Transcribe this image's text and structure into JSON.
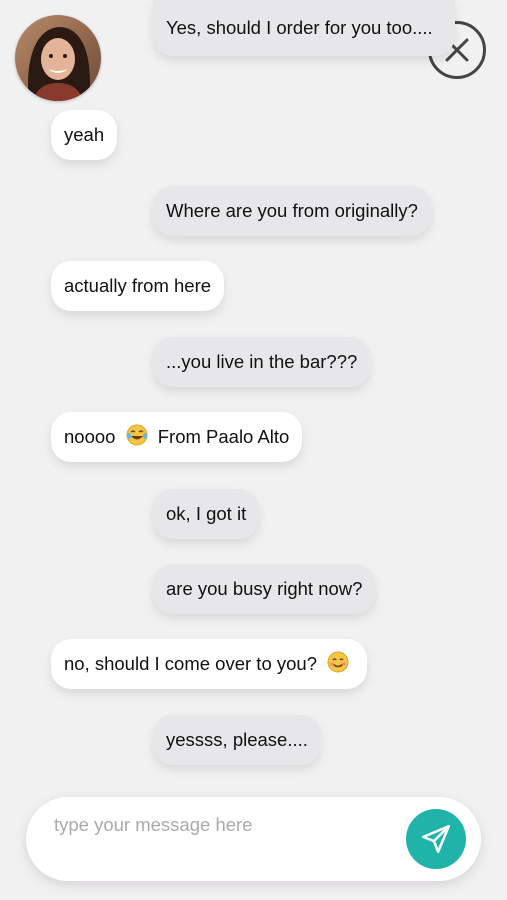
{
  "chat": {
    "contact_avatar": "woman-portrait-avatar",
    "close_icon": "close-icon",
    "messages": [
      {
        "sender": "me",
        "text": "Yes, should I order for you too...."
      },
      {
        "sender": "them",
        "text": "yeah"
      },
      {
        "sender": "me",
        "text": "Where are you from originally?"
      },
      {
        "sender": "them",
        "text": "actually from here"
      },
      {
        "sender": "me",
        "text": "...you live in the bar???"
      },
      {
        "sender": "them",
        "text_before": "noooo",
        "emoji": "tears-of-joy-emoji",
        "text_after": "From Paalo Alto"
      },
      {
        "sender": "me",
        "text": "ok, I got it"
      },
      {
        "sender": "me",
        "text": "are you busy right now?"
      },
      {
        "sender": "them",
        "text": "no, should I come over to you?",
        "emoji": "blushing-smile-emoji"
      },
      {
        "sender": "me",
        "text": "yessss, please...."
      }
    ]
  },
  "composer": {
    "placeholder": "type your message here",
    "value": "",
    "send_icon": "send-paper-plane-icon"
  },
  "colors": {
    "background": "#f2f1f2",
    "sent_bubble": "#e7e6e8",
    "received_bubble": "#ffffff",
    "send_button": "#1fb3a9"
  }
}
